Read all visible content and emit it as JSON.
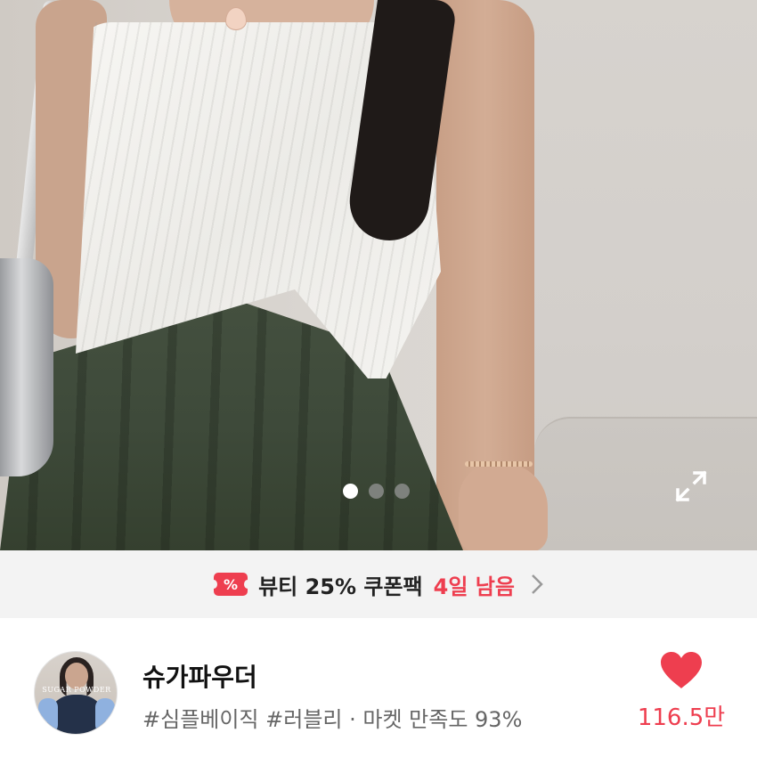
{
  "carousel": {
    "current_index": 1,
    "total": 3
  },
  "coupon": {
    "label": "뷰티 25% 쿠폰팩",
    "remaining": "4일 남음",
    "icon": "coupon-ticket-icon",
    "color": "#ee3e4f"
  },
  "seller": {
    "name": "슈가파우더",
    "tags_and_rating": "#심플베이직 #러블리 · 마켓 만족도 93%",
    "avatar_logo": "SUGAR POWDER"
  },
  "likes": {
    "count": "116.5만",
    "icon": "heart-icon"
  }
}
